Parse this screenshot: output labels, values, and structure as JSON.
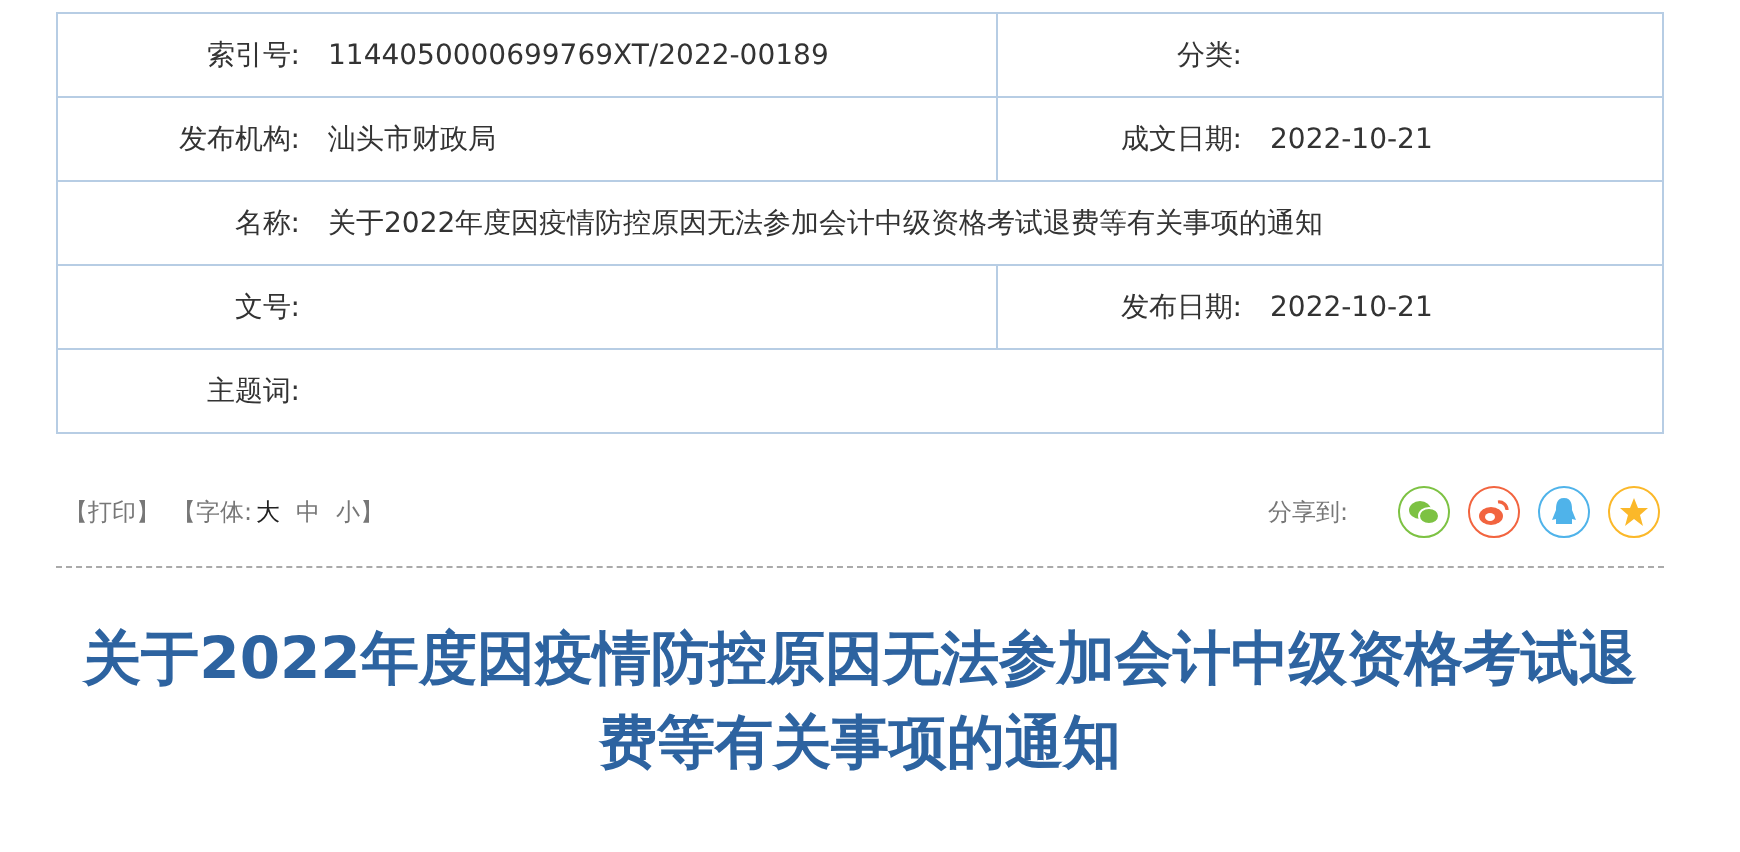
{
  "meta_rows": [
    {
      "fields": [
        {
          "label": "索引号:",
          "value": "1144050000699769XT/2022-00189"
        },
        {
          "label": "分类:"
        }
      ]
    },
    {
      "fields": [
        {
          "label": "发布机构:",
          "value": "汕头市财政局"
        },
        {
          "label": "成文日期:",
          "value": "2022-10-21"
        }
      ]
    },
    {
      "fields": [
        {
          "label": "名称:",
          "value": "关于2022年度因疫情防控原因无法参加会计中级资格考试退费等有关事项的通知"
        }
      ]
    },
    {
      "fields": [
        {
          "label": "文号:"
        },
        {
          "label": "发布日期:",
          "value": "2022-10-21"
        }
      ]
    },
    {
      "fields": [
        {
          "label": "主题词:"
        }
      ]
    }
  ],
  "toolbar": {
    "print": "【打印】",
    "font_label": "【字体:",
    "font_sizes": [
      {
        "label": "大",
        "selected": true
      },
      {
        "label": "中",
        "selected": false
      },
      {
        "label": "小",
        "selected": false
      }
    ],
    "font_close": "】",
    "share_label": "分享到:",
    "share": [
      {
        "kind": "wechat",
        "color": "#7dc243"
      },
      {
        "kind": "weibo",
        "color": "#f2643f"
      },
      {
        "kind": "qq",
        "color": "#4fb3ea"
      },
      {
        "kind": "qzone",
        "color": "#fbb829"
      }
    ]
  },
  "title": "关于2022年度因疫情防控原因无法参加会计中级资格考试退费等有关事项的通知"
}
